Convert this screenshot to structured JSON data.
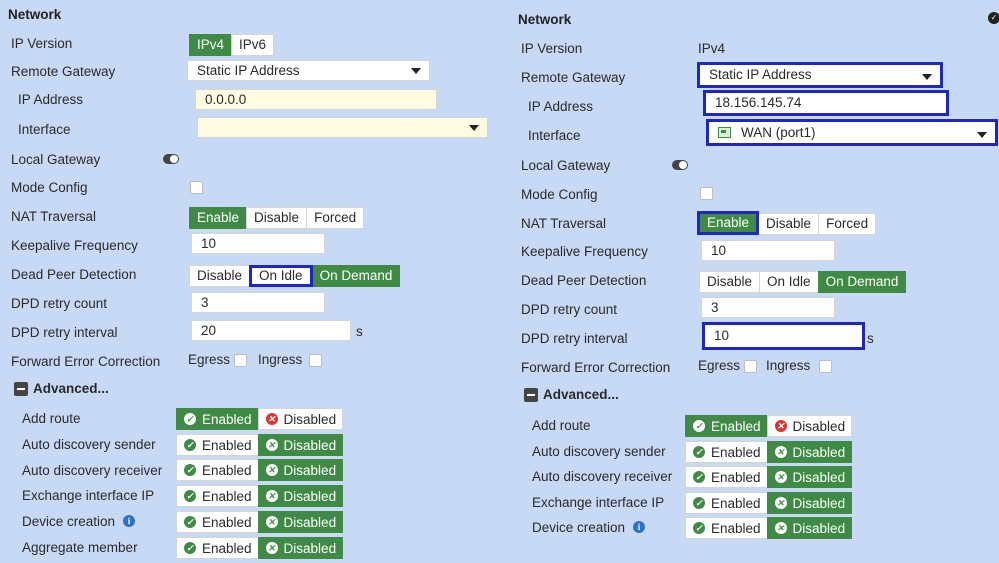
{
  "left": {
    "title": "Network",
    "ip_version_label": "IP Version",
    "ip_version_options": [
      "IPv4",
      "IPv6"
    ],
    "remote_gateway_label": "Remote Gateway",
    "remote_gateway_value": "Static IP Address",
    "ip_address_label": "IP Address",
    "ip_address_value": "0.0.0.0",
    "interface_label": "Interface",
    "interface_value": "",
    "local_gateway_label": "Local Gateway",
    "mode_config_label": "Mode Config",
    "nat_label": "NAT Traversal",
    "nat_options": [
      "Enable",
      "Disable",
      "Forced"
    ],
    "keepalive_label": "Keepalive Frequency",
    "keepalive_value": "10",
    "dpd_label": "Dead Peer Detection",
    "dpd_options": [
      "Disable",
      "On Idle",
      "On Demand"
    ],
    "dpd_count_label": "DPD retry count",
    "dpd_count_value": "3",
    "dpd_interval_label": "DPD retry interval",
    "dpd_interval_value": "20",
    "dpd_interval_unit": "s",
    "fec_label": "Forward Error Correction",
    "fec_egress": "Egress",
    "fec_ingress": "Ingress",
    "advanced_label": "Advanced...",
    "enabled_label": "Enabled",
    "disabled_label": "Disabled",
    "adv_rows": [
      "Add route",
      "Auto discovery sender",
      "Auto discovery receiver",
      "Exchange interface IP",
      "Device creation",
      "Aggregate member"
    ]
  },
  "right": {
    "title": "Network",
    "ip_version_label": "IP Version",
    "ip_version_value": "IPv4",
    "remote_gateway_label": "Remote Gateway",
    "remote_gateway_value": "Static IP Address",
    "ip_address_label": "IP Address",
    "ip_address_value": "18.156.145.74",
    "interface_label": "Interface",
    "interface_value": "WAN (port1)",
    "local_gateway_label": "Local Gateway",
    "mode_config_label": "Mode Config",
    "nat_label": "NAT Traversal",
    "nat_options": [
      "Enable",
      "Disable",
      "Forced"
    ],
    "keepalive_label": "Keepalive Frequency",
    "keepalive_value": "10",
    "dpd_label": "Dead Peer Detection",
    "dpd_options": [
      "Disable",
      "On Idle",
      "On Demand"
    ],
    "dpd_count_label": "DPD retry count",
    "dpd_count_value": "3",
    "dpd_interval_label": "DPD retry interval",
    "dpd_interval_value": "10",
    "dpd_interval_unit": "s",
    "fec_label": "Forward Error Correction",
    "fec_egress": "Egress",
    "fec_ingress": "Ingress",
    "advanced_label": "Advanced...",
    "enabled_label": "Enabled",
    "disabled_label": "Disabled",
    "adv_rows": [
      "Add route",
      "Auto discovery sender",
      "Auto discovery receiver",
      "Exchange interface IP",
      "Device creation"
    ]
  },
  "colors": {
    "background": "#c7d9f5",
    "active_green": "#3f8b46",
    "highlight_blue": "#1f27c2",
    "error_red": "#dd3333",
    "info_blue": "#2c73c4"
  },
  "icons": {
    "check": "check-circle-icon",
    "cross": "x-circle-icon",
    "info": "info-icon",
    "port": "port-icon",
    "collapse": "minus-square-icon",
    "toggle": "toggle-switch-icon"
  }
}
